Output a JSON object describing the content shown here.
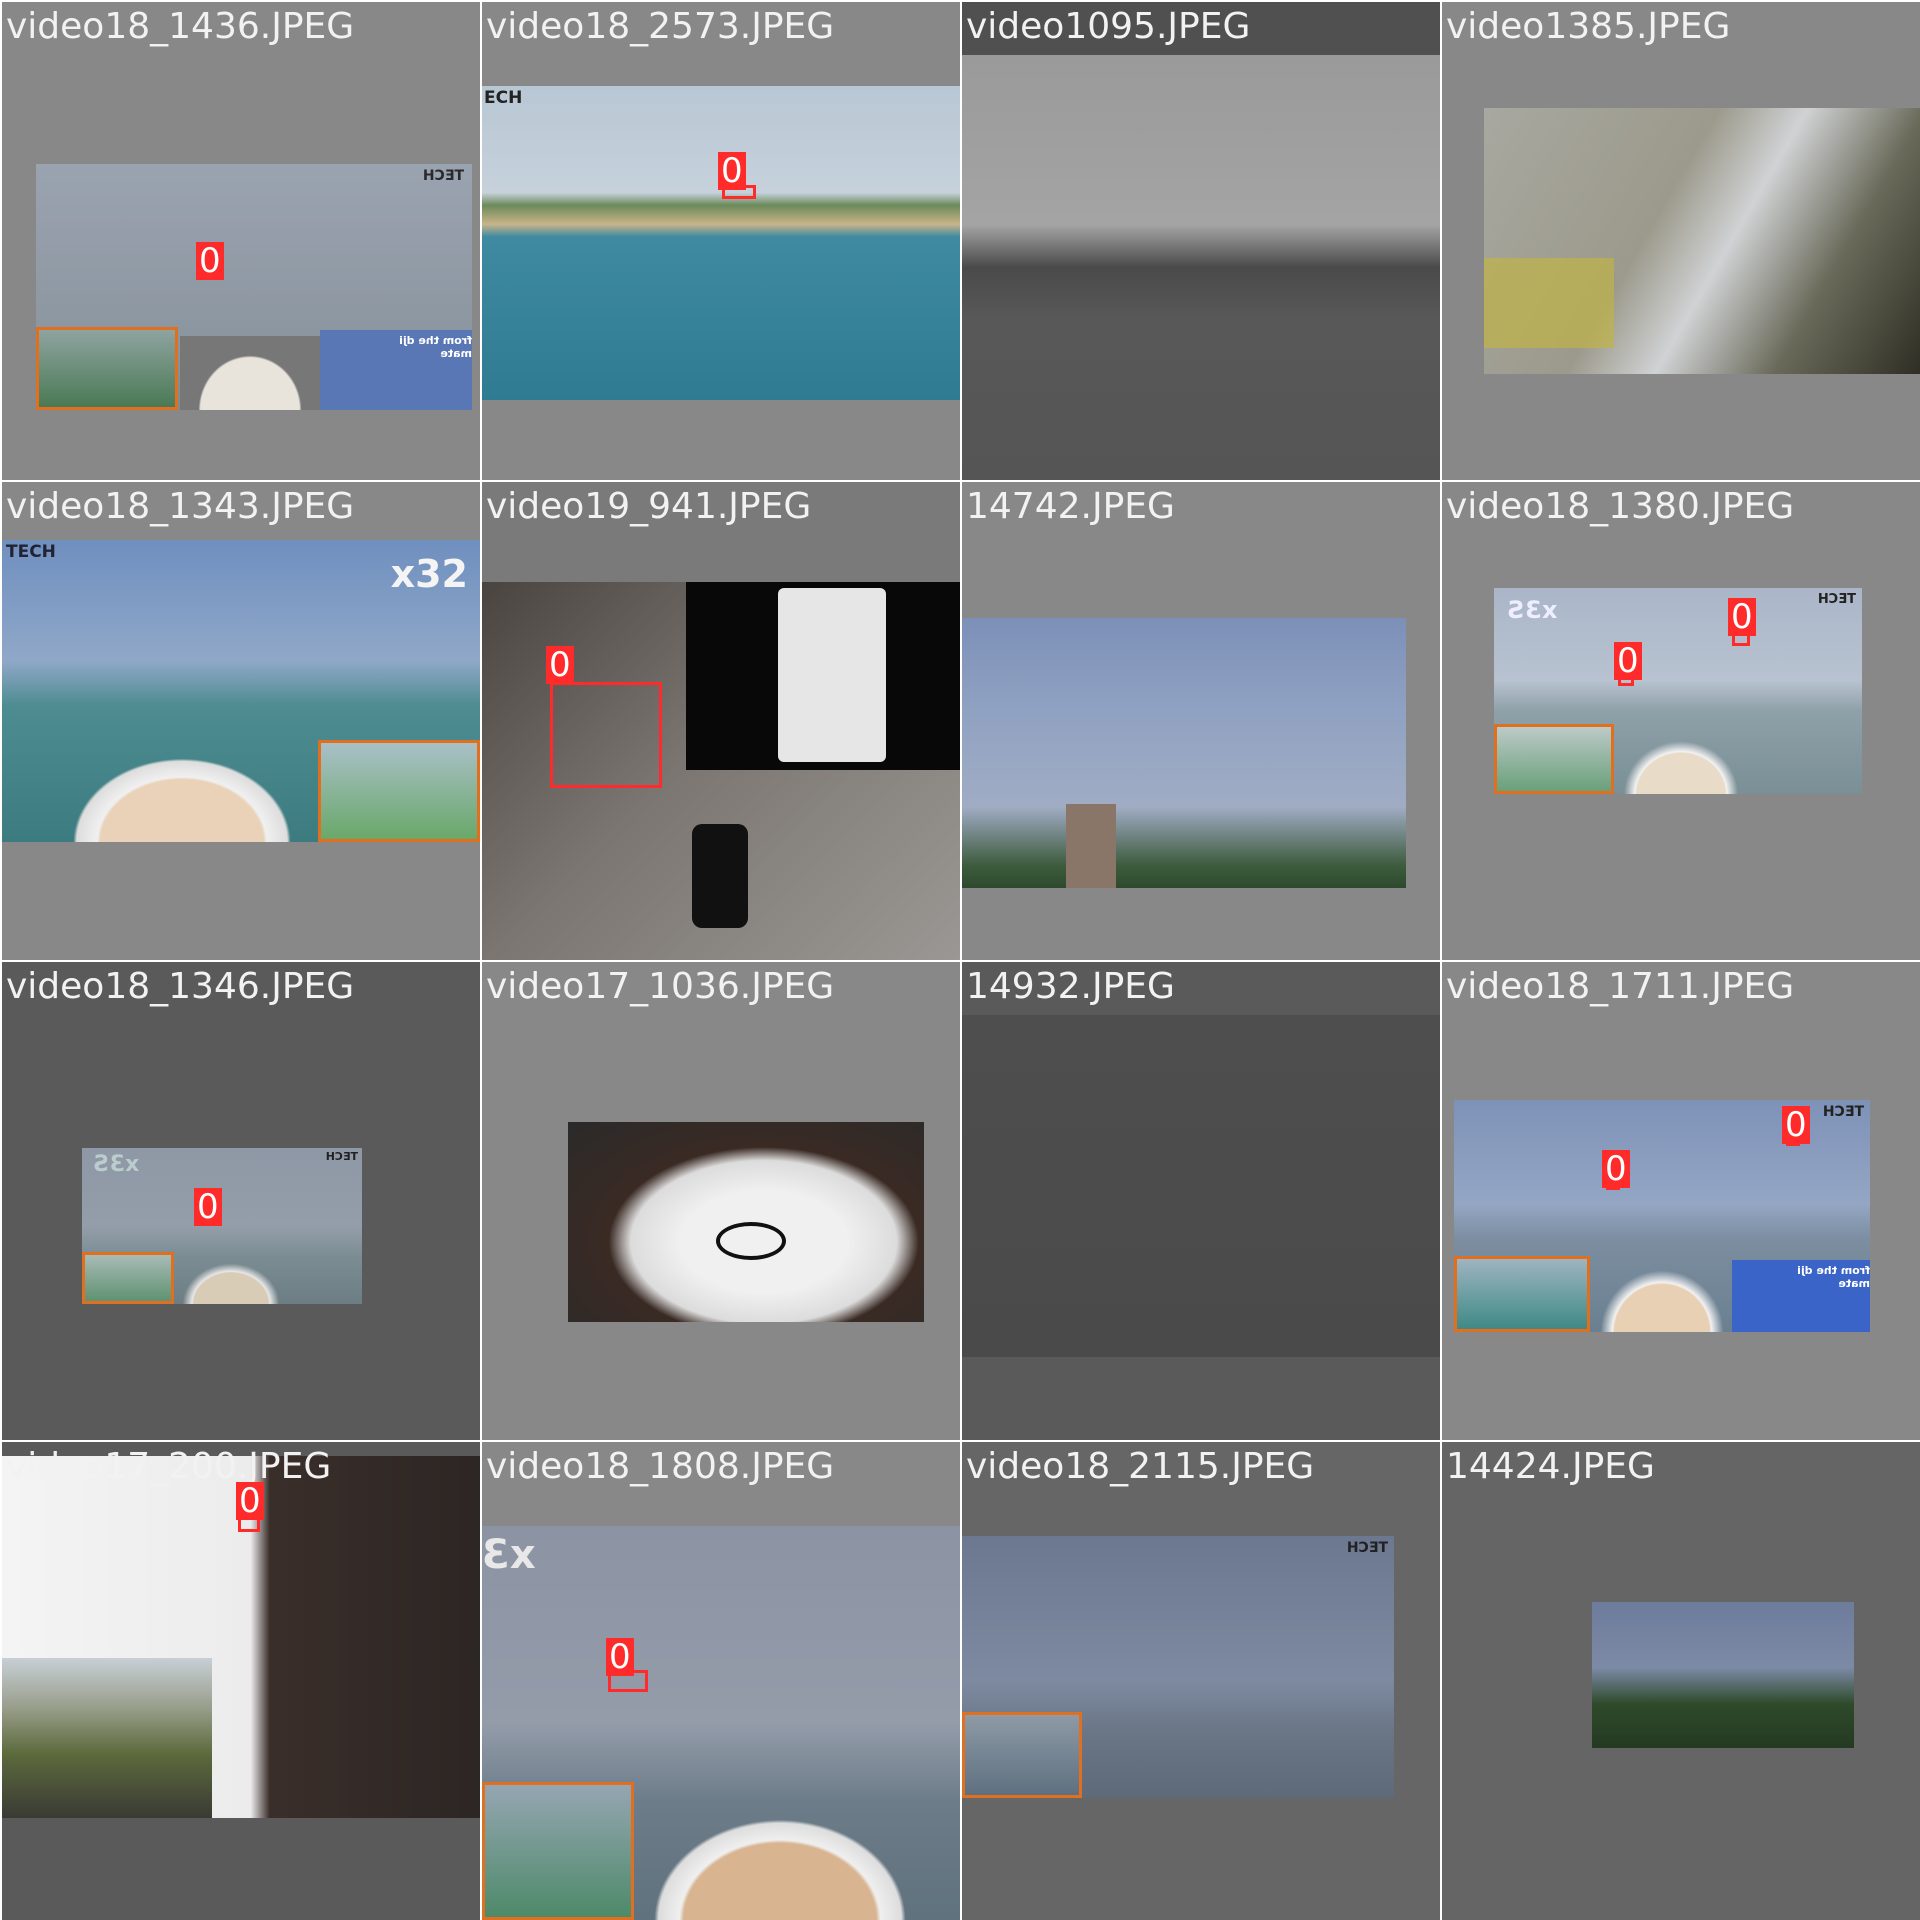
{
  "tiles": [
    {
      "caption": "video18_1436.JPEG",
      "labels": [
        "0"
      ],
      "watermark": "HƆƎT",
      "inset_text": "from the dji mate"
    },
    {
      "caption": "video18_2573.JPEG",
      "labels": [
        "0"
      ],
      "watermark": "ECH"
    },
    {
      "caption": "video1095.JPEG",
      "labels": []
    },
    {
      "caption": "video1385.JPEG",
      "labels": []
    },
    {
      "caption": "video18_1343.JPEG",
      "labels": [],
      "watermark": "TECH",
      "watermark2": "x32"
    },
    {
      "caption": "video19_941.JPEG",
      "labels": [
        "0"
      ]
    },
    {
      "caption": "14742.JPEG",
      "labels": []
    },
    {
      "caption": "video18_1380.JPEG",
      "labels": [
        "0",
        "0"
      ],
      "watermark": "ƧƐx",
      "watermark2": "HƆƎT"
    },
    {
      "caption": "video18_1346.JPEG",
      "labels": [
        "0"
      ],
      "watermark": "ƧƐx",
      "watermark2": "HƆƎT"
    },
    {
      "caption": "video17_1036.JPEG",
      "labels": []
    },
    {
      "caption": "14932.JPEG",
      "labels": []
    },
    {
      "caption": "video18_1711.JPEG",
      "labels": [
        "0",
        "0"
      ],
      "watermark": "HƆƎT",
      "inset_text": "from the dji mate"
    },
    {
      "caption": "video17_200.JPEG",
      "labels": [
        "0"
      ]
    },
    {
      "caption": "video18_1808.JPEG",
      "labels": [
        "0"
      ],
      "watermark": "Ɛx"
    },
    {
      "caption": "video18_2115.JPEG",
      "labels": [],
      "watermark": "HƆƎT"
    },
    {
      "caption": "14424.JPEG",
      "labels": []
    }
  ],
  "colors": {
    "box": "#ff2b2b",
    "inset_border": "#e07020",
    "tile_bg": "#6f6f6f"
  }
}
